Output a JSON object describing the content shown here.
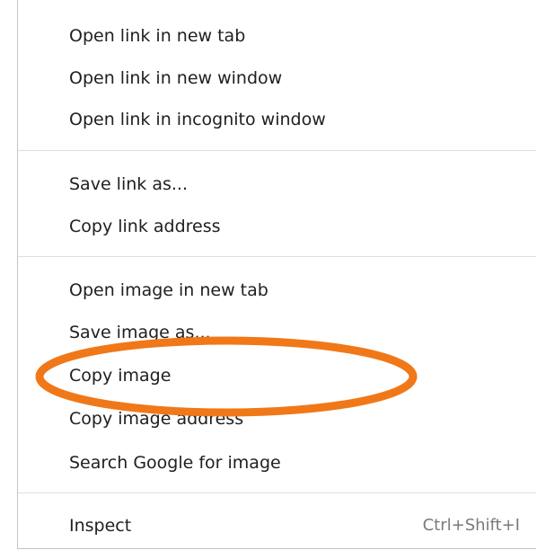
{
  "menu": {
    "groups": [
      {
        "items": [
          {
            "label": "Open link in new tab"
          },
          {
            "label": "Open link in new window"
          },
          {
            "label": "Open link in incognito window"
          }
        ]
      },
      {
        "items": [
          {
            "label": "Save link as..."
          },
          {
            "label": "Copy link address"
          }
        ]
      },
      {
        "items": [
          {
            "label": "Open image in new tab"
          },
          {
            "label": "Save image as..."
          },
          {
            "label": "Copy image"
          },
          {
            "label": "Copy image address"
          },
          {
            "label": "Search Google for image"
          }
        ]
      },
      {
        "items": [
          {
            "label": "Inspect",
            "shortcut": "Ctrl+Shift+I"
          }
        ]
      }
    ]
  },
  "annotation": {
    "shape": "ellipse",
    "target": "Copy image",
    "color": "#f07818"
  }
}
